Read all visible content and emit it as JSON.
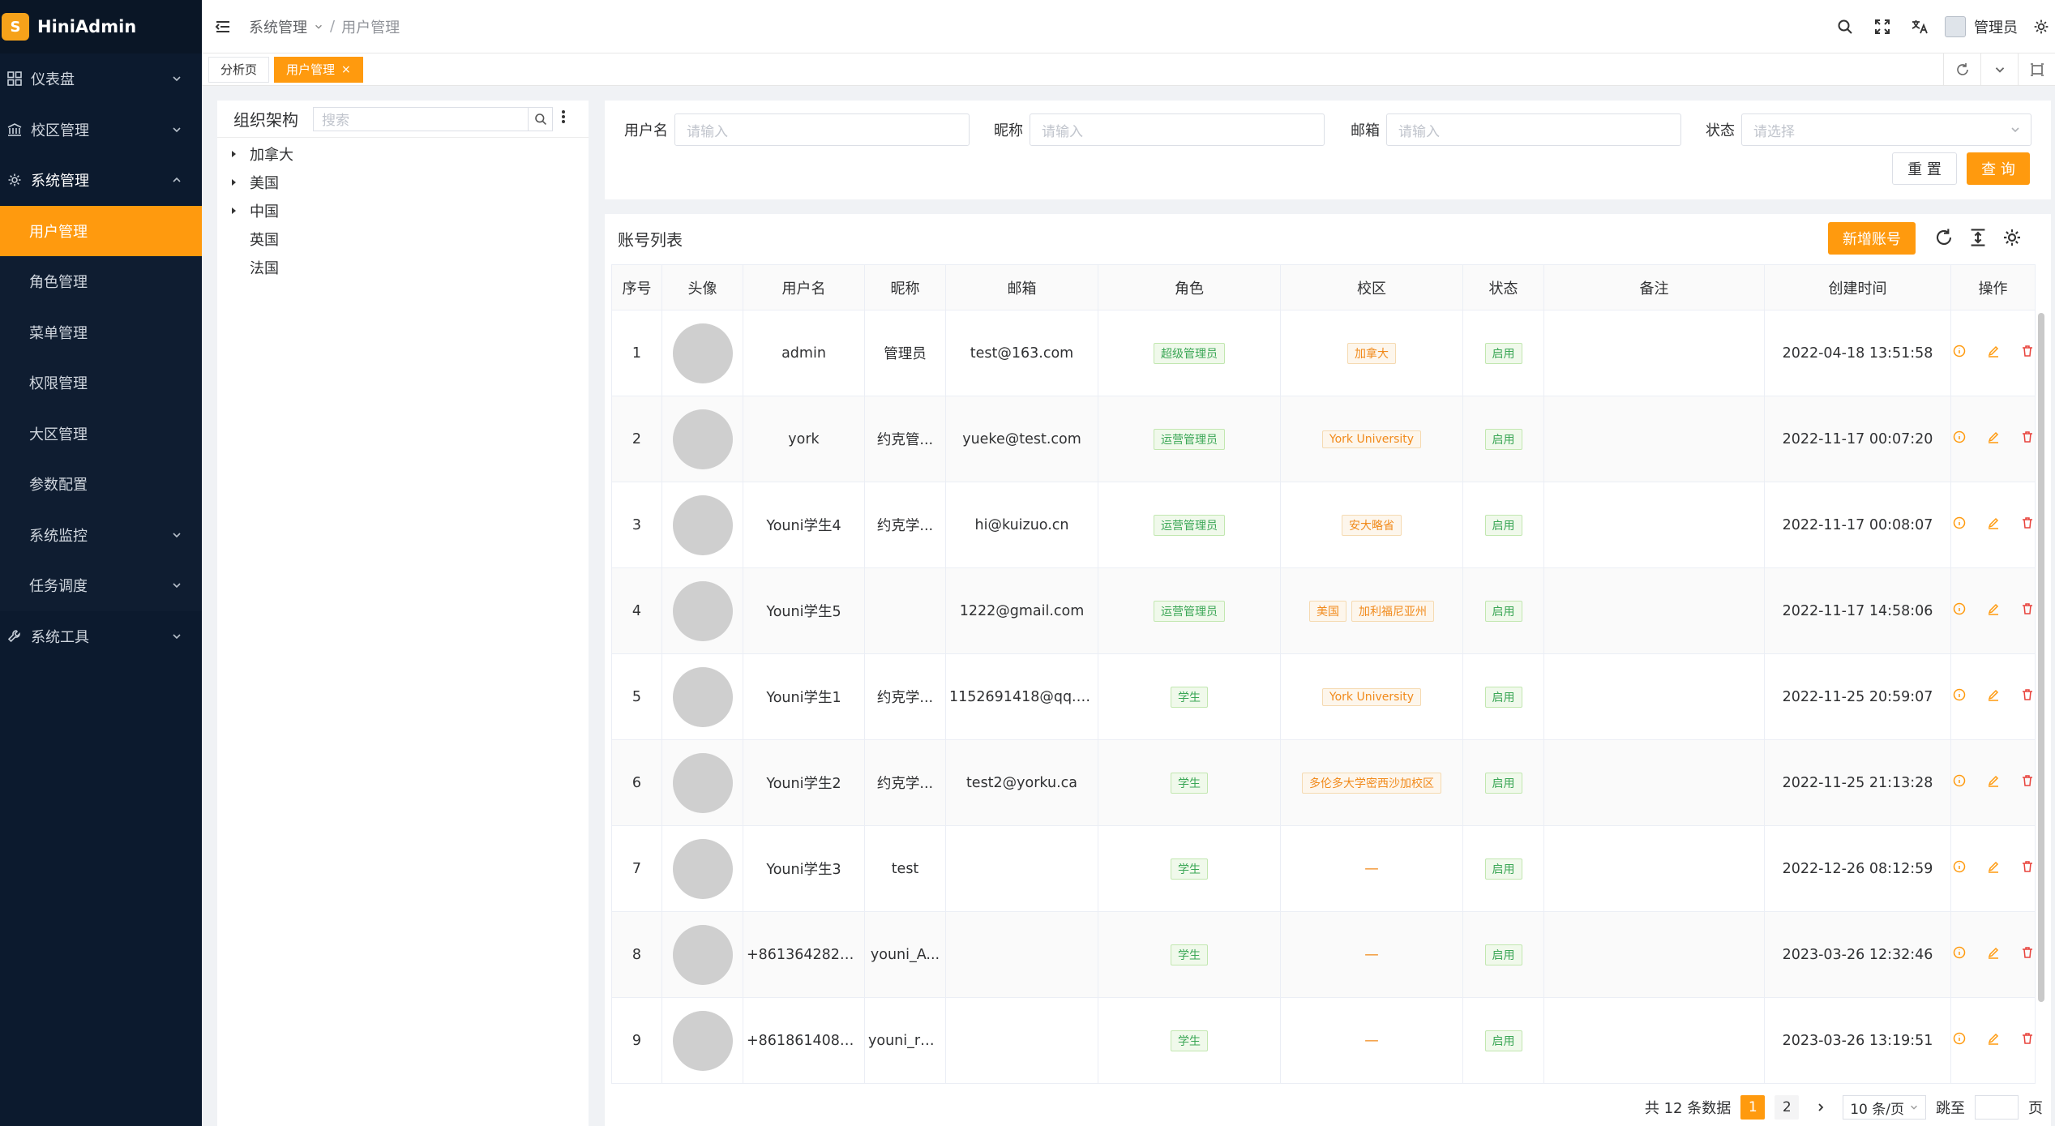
{
  "app": {
    "logo_text": "HiniAdmin",
    "logo_glyph": "S"
  },
  "sidebar": {
    "items": [
      {
        "label": "仪表盘",
        "icon": "dashboard-icon"
      },
      {
        "label": "校区管理",
        "icon": "campus-icon"
      },
      {
        "label": "系统管理",
        "icon": "gear-icon"
      },
      {
        "label": "系统工具",
        "icon": "tools-icon"
      }
    ],
    "sub_items": [
      {
        "label": "用户管理"
      },
      {
        "label": "角色管理"
      },
      {
        "label": "菜单管理"
      },
      {
        "label": "权限管理"
      },
      {
        "label": "大区管理"
      },
      {
        "label": "参数配置"
      },
      {
        "label": "系统监控"
      },
      {
        "label": "任务调度"
      }
    ]
  },
  "header": {
    "breadcrumb": {
      "parent": "系统管理",
      "separator": "/",
      "current": "用户管理"
    },
    "user_name": "管理员"
  },
  "tabs": [
    {
      "label": "分析页"
    },
    {
      "label": "用户管理",
      "close": "×"
    }
  ],
  "tree": {
    "title": "组织架构",
    "search_placeholder": "搜索",
    "nodes": [
      "加拿大",
      "美国",
      "中国",
      "英国",
      "法国"
    ]
  },
  "filters": {
    "username_label": "用户名",
    "nickname_label": "昵称",
    "email_label": "邮箱",
    "status_label": "状态",
    "input_placeholder": "请输入",
    "select_placeholder": "请选择",
    "reset_label": "重 置",
    "query_label": "查 询"
  },
  "list": {
    "title": "账号列表",
    "add_label": "新增账号",
    "columns": [
      "序号",
      "头像",
      "用户名",
      "昵称",
      "邮箱",
      "角色",
      "校区",
      "状态",
      "备注",
      "创建时间",
      "操作"
    ],
    "rows": [
      {
        "no": "1",
        "username": "admin",
        "nickname": "管理员",
        "email": "test@163.com",
        "role": "超级管理员",
        "campus": [
          "加拿大"
        ],
        "status": "启用",
        "created": "2022-04-18 13:51:58"
      },
      {
        "no": "2",
        "username": "york",
        "nickname": "约克管...",
        "email": "yueke@test.com",
        "role": "运营管理员",
        "campus": [
          "York University"
        ],
        "status": "启用",
        "created": "2022-11-17 00:07:20"
      },
      {
        "no": "3",
        "username": "Youni学生4",
        "nickname": "约克学...",
        "email": "hi@kuizuo.cn",
        "role": "运营管理员",
        "campus": [
          "安大略省"
        ],
        "status": "启用",
        "created": "2022-11-17 00:08:07"
      },
      {
        "no": "4",
        "username": "Youni学生5",
        "nickname": "",
        "email": "1222@gmail.com",
        "role": "运营管理员",
        "campus": [
          "美国",
          "加利福尼亚州"
        ],
        "status": "启用",
        "created": "2022-11-17 14:58:06"
      },
      {
        "no": "5",
        "username": "Youni学生1",
        "nickname": "约克学...",
        "email": "1152691418@qq.c...",
        "role": "学生",
        "campus": [
          "York University"
        ],
        "status": "启用",
        "created": "2022-11-25 20:59:07"
      },
      {
        "no": "6",
        "username": "Youni学生2",
        "nickname": "约克学...",
        "email": "test2@yorku.ca",
        "role": "学生",
        "campus": [
          "多伦多大学密西沙加校区"
        ],
        "status": "启用",
        "created": "2022-11-25 21:13:28"
      },
      {
        "no": "7",
        "username": "Youni学生3",
        "nickname": "test",
        "email": "",
        "role": "学生",
        "campus": [],
        "status": "启用",
        "created": "2022-12-26 08:12:59"
      },
      {
        "no": "8",
        "username": "+86136428208...",
        "nickname": "youni_A...",
        "email": "",
        "role": "学生",
        "campus": [],
        "status": "启用",
        "created": "2023-03-26 12:32:46"
      },
      {
        "no": "9",
        "username": "+86186140899...",
        "nickname": "youni_r8...",
        "email": "",
        "role": "学生",
        "campus": [],
        "status": "启用",
        "created": "2023-03-26 13:19:51"
      }
    ],
    "empty_campus": "—"
  },
  "pagination": {
    "total_text": "共 12 条数据",
    "pages": [
      "1",
      "2"
    ],
    "page_size": "10 条/页",
    "jump_label": "跳至",
    "page_suffix": "页"
  },
  "colors": {
    "accent": "#ff9a0e",
    "sidebar_bg": "#0c1a2e",
    "tag_green": "#3aa655",
    "tag_orange": "#f18a1b",
    "danger": "#e8433c"
  }
}
